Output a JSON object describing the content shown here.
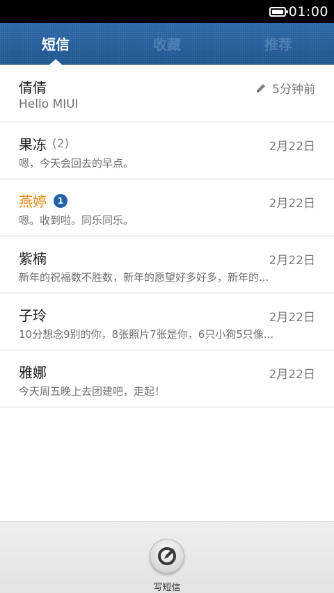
{
  "status_bar": {
    "time": "01:00"
  },
  "tabs": [
    {
      "label": "短信",
      "active": true
    },
    {
      "label": "收藏",
      "active": false
    },
    {
      "label": "推荐",
      "active": false
    }
  ],
  "conversations": [
    {
      "name": "倩倩",
      "count": "",
      "unread": "",
      "date": "5分钟前",
      "draft": true,
      "preview": "Hello MIUI"
    },
    {
      "name": "果冻",
      "count": "(2)",
      "unread": "",
      "date": "2月22日",
      "draft": false,
      "preview": "嗯，今天会回去的早点。"
    },
    {
      "name": "燕婷",
      "count": "",
      "unread": "1",
      "date": "2月22日",
      "draft": false,
      "preview": "嗯。收到啦。同乐同乐。"
    },
    {
      "name": "紫楠",
      "count": "",
      "unread": "",
      "date": "2月22日",
      "draft": false,
      "preview": "新年的祝福数不胜数，新年的愿望好多好多，新年的..."
    },
    {
      "name": "子玲",
      "count": "",
      "unread": "",
      "date": "2月22日",
      "draft": false,
      "preview": "10分想念9别的你，8张照片7张是你，6只小狗5只像..."
    },
    {
      "name": "雅娜",
      "count": "",
      "unread": "",
      "date": "2月22日",
      "draft": false,
      "preview": "今天周五晚上去团建吧，走起！"
    }
  ],
  "compose": {
    "label": "写短信",
    "icon": "compose-icon"
  },
  "colors": {
    "tab_bar": "#2160a0",
    "unread_name": "#f08a16",
    "badge": "#2262a8"
  }
}
